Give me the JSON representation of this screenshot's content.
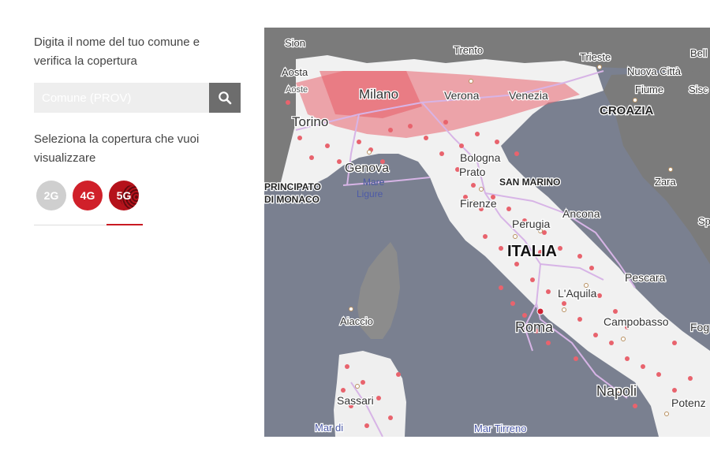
{
  "panel": {
    "intro_text": "Digita il nome del tuo comune e verifica la copertura",
    "search": {
      "placeholder": "Comune (PROV)",
      "value": ""
    },
    "select_text": "Seleziona la copertura che vuoi visualizzare",
    "technologies": [
      {
        "label": "2G",
        "color": "#cfcfcf",
        "selected": false
      },
      {
        "label": "4G",
        "color": "#d0202a",
        "selected": false
      },
      {
        "label": "5G",
        "color": "#b5121b",
        "selected": true
      }
    ]
  },
  "map": {
    "icons": [
      "search-icon"
    ],
    "colors": {
      "sea": "#7a8090",
      "land": "#f1f1f1",
      "foreign_land": "#7d7d7d",
      "coverage": "#e8636d",
      "roads": "#e3c3f0"
    },
    "labels": {
      "sion": "Sion",
      "trento": "Trento",
      "trieste": "Trieste",
      "bell": "Bell",
      "aosta": "Aosta",
      "aoste": "Aoste",
      "nuova_citta": "Nuova Città",
      "milano": "Milano",
      "verona": "Verona",
      "venezia": "Venezia",
      "fiume": "Fiume",
      "sisc": "Sisc",
      "croazia": "CROAZIA",
      "torino": "Torino",
      "bologna": "Bologna",
      "genova": "Genova",
      "prato": "Prato",
      "san_marino": "SAN MARINO",
      "zara": "Zara",
      "principato": "PRINCIPATO",
      "di_monaco": "DI MONACO",
      "mare": "Mare",
      "ligure": "Ligure",
      "firenze": "Firenze",
      "ancona": "Ancona",
      "perugia": "Perugia",
      "italia": "ITALIA",
      "pescara": "Pescara",
      "aquila": "L'Aquila",
      "aiaccio": "Aiaccio",
      "roma": "Roma",
      "campobasso": "Campobasso",
      "fog": "Fog",
      "napoli": "Napoli",
      "potenz": "Potenz",
      "sassari": "Sassari",
      "mar_di": "Mar di",
      "mar_tirreno": "Mar Tirreno",
      "sp": "Sp"
    }
  }
}
